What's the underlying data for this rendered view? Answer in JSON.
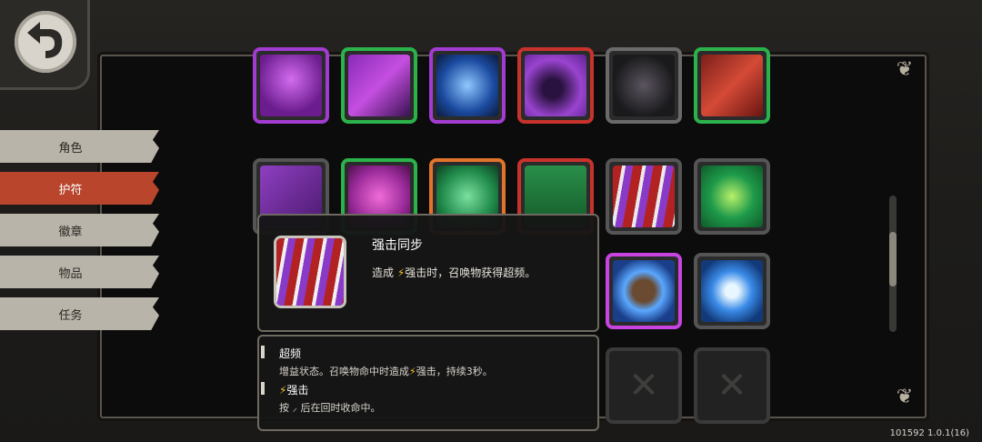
{
  "menu": {
    "tabs": [
      {
        "label": "角色"
      },
      {
        "label": "护符"
      },
      {
        "label": "徽章"
      },
      {
        "label": "物品"
      },
      {
        "label": "任务"
      }
    ],
    "active_index": 1
  },
  "tooltip": {
    "title": "强击同步",
    "desc_prefix": "造成",
    "desc_keyword": "强击",
    "desc_suffix": "时，召唤物获得超频。"
  },
  "glossary": {
    "entry1_title": "超频",
    "entry1_text_a": "增益状态。召唤物命中时造成",
    "entry1_keyword": "强击",
    "entry1_text_b": "，持续3秒。",
    "entry2_title": "强击",
    "entry2_text_a": "按",
    "entry2_text_b": "后在回时收命中。"
  },
  "version": "101592 1.0.1(16)",
  "colors": {
    "accent_tab": "#b8452c",
    "tab_bg": "#b9b4a9",
    "bolt": "#f2c12e",
    "border_purple": "#a23bd0",
    "border_green": "#2cb24a",
    "border_orange": "#e0742a",
    "border_red": "#c7332b"
  }
}
